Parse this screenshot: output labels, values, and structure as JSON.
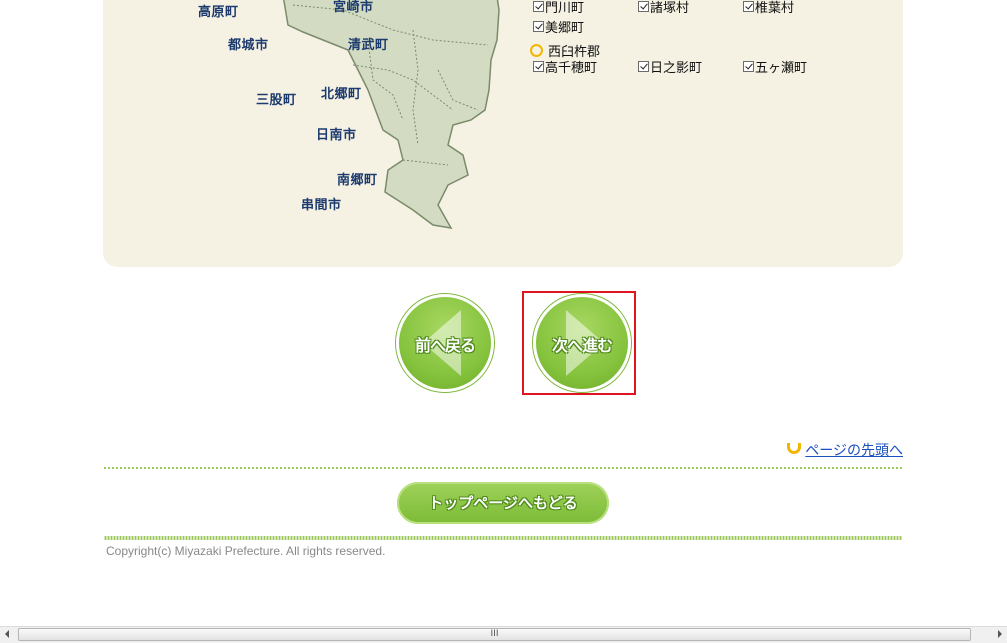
{
  "map": {
    "labels": [
      "高原町",
      "宮崎市",
      "都城市",
      "清武町",
      "三股町",
      "北郷町",
      "日南市",
      "南郷町",
      "串間市"
    ]
  },
  "municipalities": {
    "row1": [
      "門川町",
      "諸塚村",
      "椎葉村"
    ],
    "row2": [
      "美郷町"
    ],
    "county": "西臼杵郡",
    "row3": [
      "高千穂町",
      "日之影町",
      "五ヶ瀬町"
    ]
  },
  "nav": {
    "prev_label": "前へ戻る",
    "next_label": "次へ進む"
  },
  "page_top": "ページの先頭へ",
  "top_page_button": "トップページへもどる",
  "copyright": "Copyright(c) Miyazaki Prefecture. All rights reserved.",
  "colors": {
    "panel_bg": "#f5f2e4",
    "button_green": "#84c23c",
    "highlight_red": "#e0141e",
    "link_blue": "#1a4fc0"
  }
}
